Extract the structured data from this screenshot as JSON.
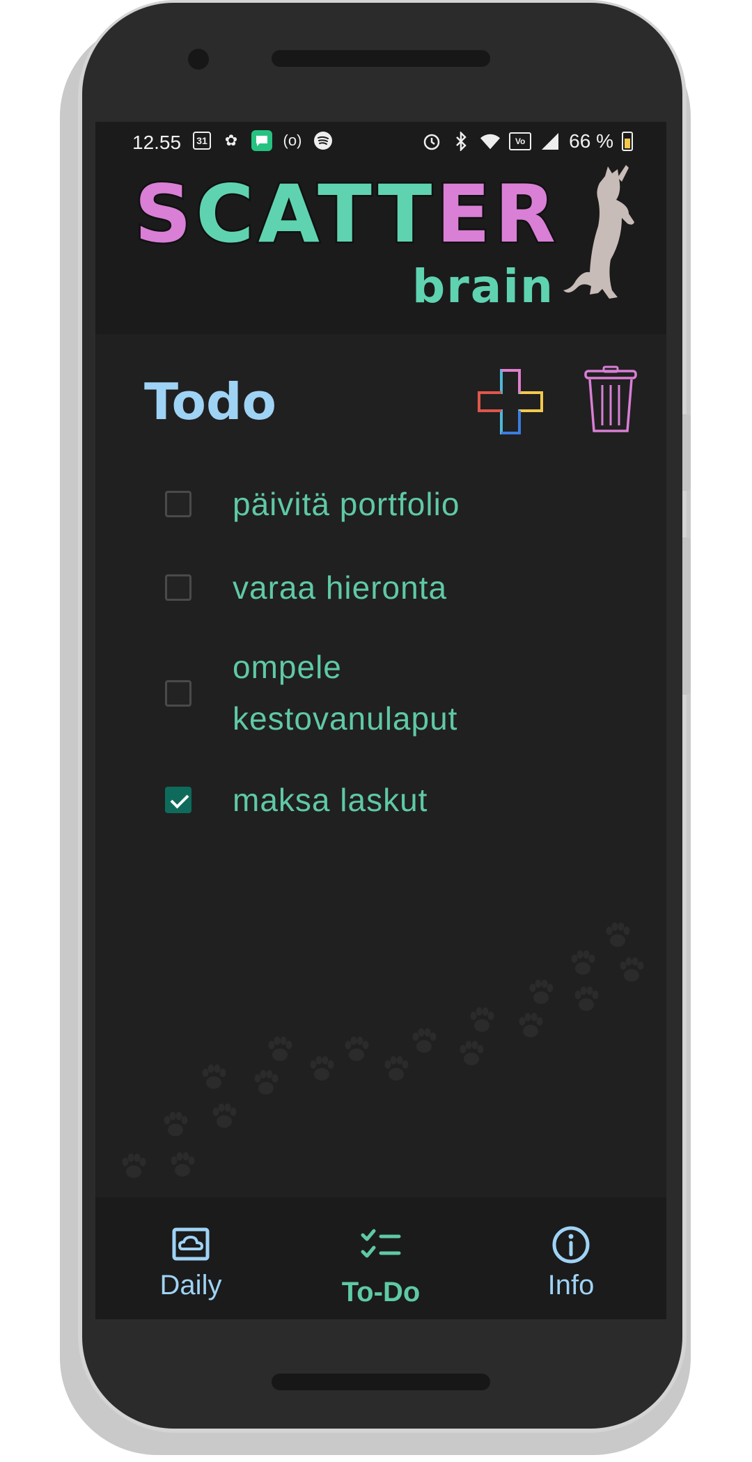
{
  "status_bar": {
    "time": "12.55",
    "calendar_day": "31",
    "battery": "66 %"
  },
  "header": {
    "logo_scatter": "SCATTER",
    "logo_brain": "brain"
  },
  "colors": {
    "logo_pink": "#d97fd6",
    "logo_teal": "#5fd3b0",
    "title_blue": "#9fd3f5",
    "todo_text": "#5fc9a6",
    "checked": "#0e6b5b"
  },
  "page": {
    "title": "Todo",
    "add_icon": "plus-icon",
    "delete_icon": "trash-icon"
  },
  "todos": [
    {
      "text": "päivitä portfolio",
      "checked": false
    },
    {
      "text": "varaa hieronta",
      "checked": false
    },
    {
      "text": "ompele kestovanulaput",
      "checked": false
    },
    {
      "text": "maksa laskut",
      "checked": true
    }
  ],
  "nav": {
    "items": [
      {
        "label": "Daily",
        "icon": "cloud-photo-icon",
        "active": false
      },
      {
        "label": "To-Do",
        "icon": "checklist-icon",
        "active": true
      },
      {
        "label": "Info",
        "icon": "info-icon",
        "active": false
      }
    ]
  }
}
